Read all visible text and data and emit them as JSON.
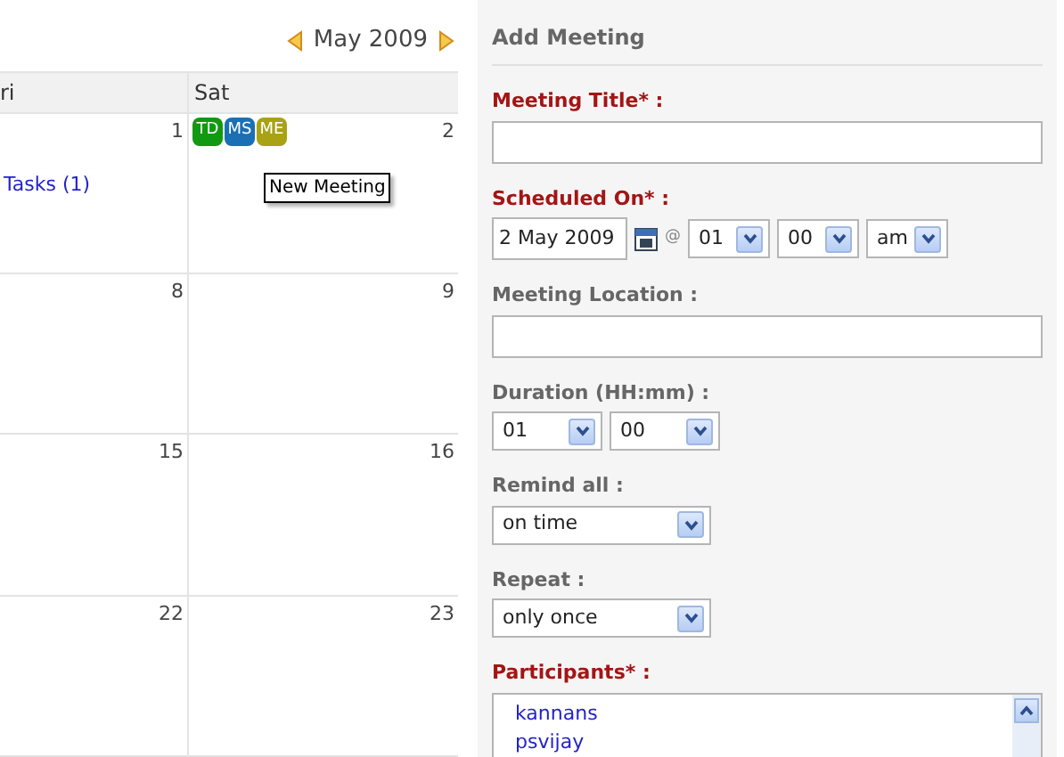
{
  "calendar": {
    "month_label": "May 2009",
    "day_headers": [
      "ri",
      "Sat"
    ],
    "weeks": [
      {
        "days": [
          {
            "number": "1",
            "links": [
              "Tasks (1)"
            ]
          },
          {
            "number": "2",
            "badges": [
              {
                "label": "TD",
                "color": "#119911"
              },
              {
                "label": "MS",
                "color": "#1a6fb5"
              },
              {
                "label": "ME",
                "color": "#a8a214"
              }
            ],
            "tooltip": "New Meeting"
          }
        ]
      },
      {
        "days": [
          {
            "number": "8"
          },
          {
            "number": "9"
          }
        ]
      },
      {
        "days": [
          {
            "number": "15"
          },
          {
            "number": "16"
          }
        ]
      },
      {
        "days": [
          {
            "number": "22"
          },
          {
            "number": "23"
          }
        ]
      }
    ]
  },
  "form": {
    "title": "Add Meeting",
    "fields": [
      {
        "kind": "text",
        "label": "Meeting Title* :",
        "required": true
      },
      {
        "kind": "datetime",
        "label": "Scheduled On* :",
        "required": true,
        "date": "2 May 2009",
        "at": "@",
        "hour": "01",
        "minute": "00",
        "ampm": "am"
      },
      {
        "kind": "text",
        "label": "Meeting Location :",
        "required": false
      },
      {
        "kind": "duration",
        "label": "Duration (HH:mm) :",
        "required": false,
        "hours": "01",
        "minutes": "00"
      },
      {
        "kind": "select",
        "label": "Remind all :",
        "required": false,
        "value": "on time"
      },
      {
        "kind": "select",
        "label": "Repeat :",
        "required": false,
        "value": "only once"
      },
      {
        "kind": "listbox",
        "label": "Participants* :",
        "required": true,
        "items": [
          "kannans",
          "psvijay"
        ]
      }
    ]
  }
}
